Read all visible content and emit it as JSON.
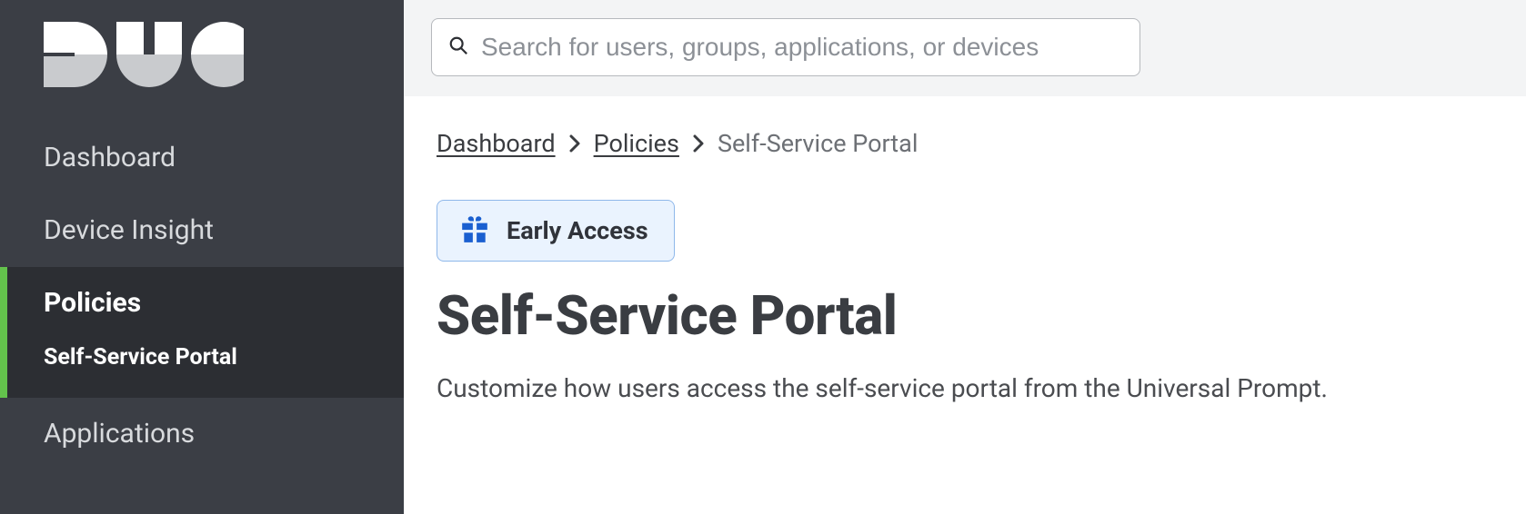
{
  "search": {
    "placeholder": "Search for users, groups, applications, or devices"
  },
  "sidebar": {
    "items": [
      {
        "label": "Dashboard"
      },
      {
        "label": "Device Insight"
      }
    ],
    "active_group": {
      "label": "Policies",
      "subitem": "Self-Service Portal"
    },
    "after": [
      {
        "label": "Applications"
      }
    ]
  },
  "breadcrumb": {
    "a": "Dashboard",
    "b": "Policies",
    "current": "Self-Service Portal"
  },
  "badge": {
    "label": "Early Access"
  },
  "page": {
    "title": "Self-Service Portal",
    "description": "Customize how users access the self-service portal from the Universal Prompt."
  }
}
